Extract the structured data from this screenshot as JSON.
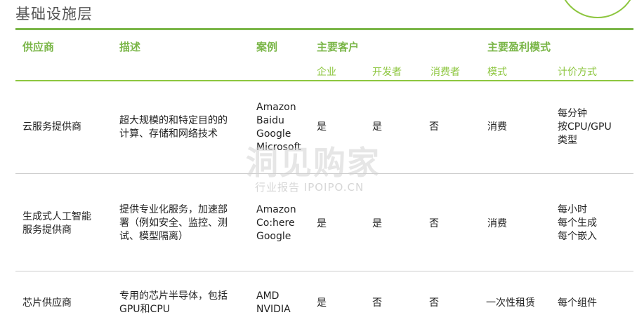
{
  "page_title": "基础设施层",
  "header": {
    "supplier": "供应商",
    "description": "描述",
    "example": "案例",
    "main_customers": "主要客户",
    "profit_model": "主要盈利模式"
  },
  "subheader": {
    "enterprise": "企业",
    "developer": "开发者",
    "consumer": "消费者",
    "mode": "模式",
    "pricing": "计价方式"
  },
  "rows": [
    {
      "supplier": "云服务提供商",
      "description": "超大规模的和特定目的的\n计算、存储和网络技术",
      "example": "Amazon\nBaidu\nGoogle\nMicrosoft",
      "enterprise": "是",
      "developer": "是",
      "consumer": "否",
      "mode": "消费",
      "pricing": "每分钟\n按CPU/GPU\n类型"
    },
    {
      "supplier": "生成式人工智能\n服务提供商",
      "description": "提供专业化服务，加速部\n署（例如安全、监控、测\n试、模型隔离）",
      "example": "Amazon\nCo:here\nGoogle",
      "enterprise": "是",
      "developer": "是",
      "consumer": "否",
      "mode": "消费",
      "pricing": "每小时\n每个生成\n每个嵌入"
    },
    {
      "supplier": "芯片供应商",
      "description": "专用的芯片半导体，包括\nGPU和CPU",
      "example": "AMD\nNVIDIA",
      "enterprise": "是",
      "developer": "否",
      "consumer": "否",
      "mode": "一次性租赁",
      "pricing": "每个组件"
    }
  ],
  "watermark": {
    "main": "洞见购家",
    "sub": "行业报告 IPOIPO.CN"
  },
  "colors": {
    "accent": "#7ab648",
    "accent_light": "#8dc63f",
    "divider": "#cccccc"
  }
}
